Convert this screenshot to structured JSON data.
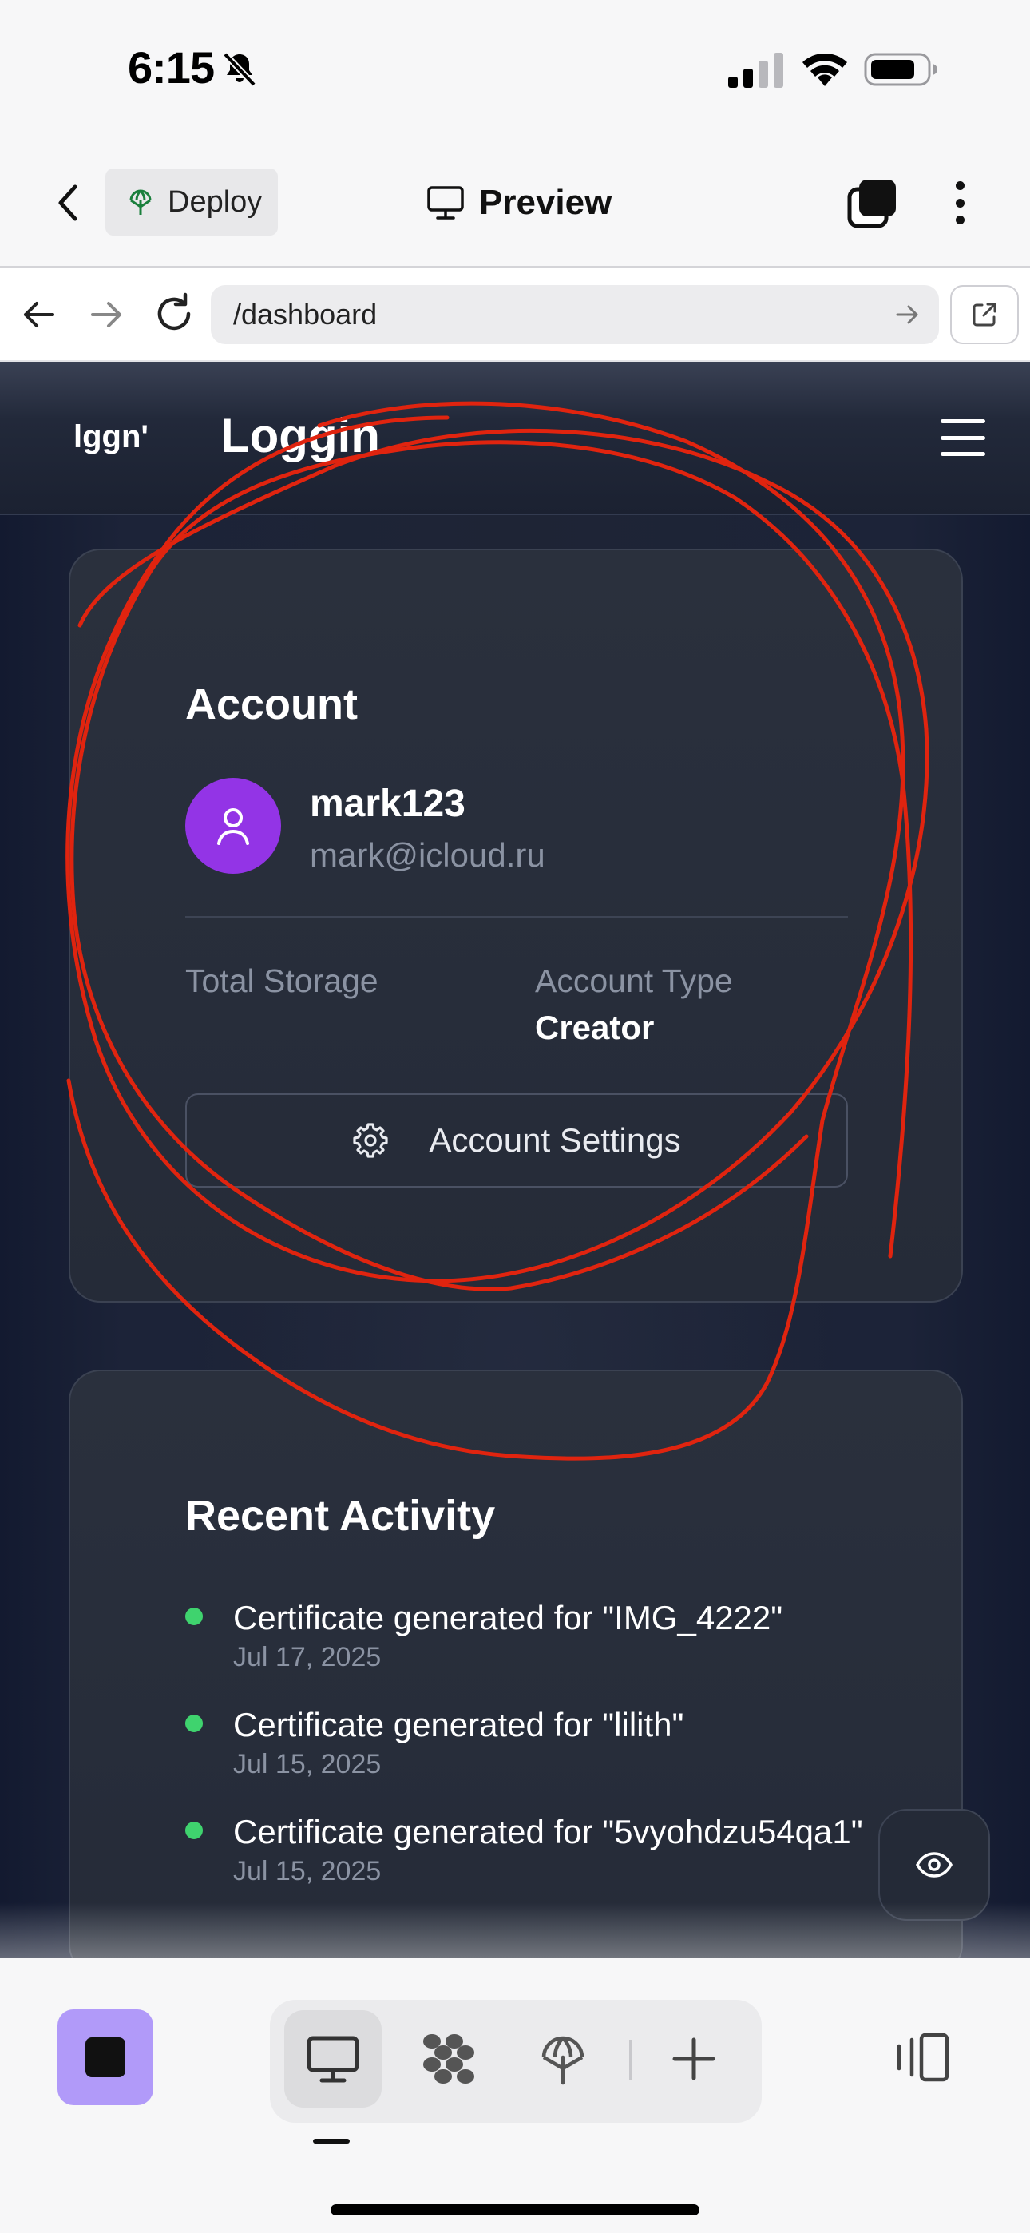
{
  "status_bar": {
    "time": "6:15",
    "icons": [
      "bell-slash-icon",
      "cellular-signal-icon",
      "wifi-icon",
      "battery-icon"
    ]
  },
  "toolbar": {
    "deploy_label": "Deploy",
    "title": "Preview"
  },
  "browser": {
    "url": "/dashboard"
  },
  "site": {
    "logo": "lggn'",
    "name": "Loggin"
  },
  "account": {
    "title": "Account",
    "username": "mark123",
    "email": "mark@icloud.ru",
    "storage_label": "Total Storage",
    "type_label": "Account Type",
    "type_value": "Creator",
    "settings_label": "Account Settings"
  },
  "activity": {
    "title": "Recent Activity",
    "items": [
      {
        "text": "Certificate generated for \"IMG_4222\"",
        "date": "Jul 17, 2025"
      },
      {
        "text": "Certificate generated for \"lilith\"",
        "date": "Jul 15, 2025"
      },
      {
        "text": "Certificate generated for \"5vyohdzu54qa1\"",
        "date": "Jul 15, 2025"
      }
    ]
  },
  "colors": {
    "annotation_stroke": "#e0240f",
    "avatar": "#9334e6",
    "status_dot": "#3fd36e",
    "stop_button": "#b19af9"
  }
}
